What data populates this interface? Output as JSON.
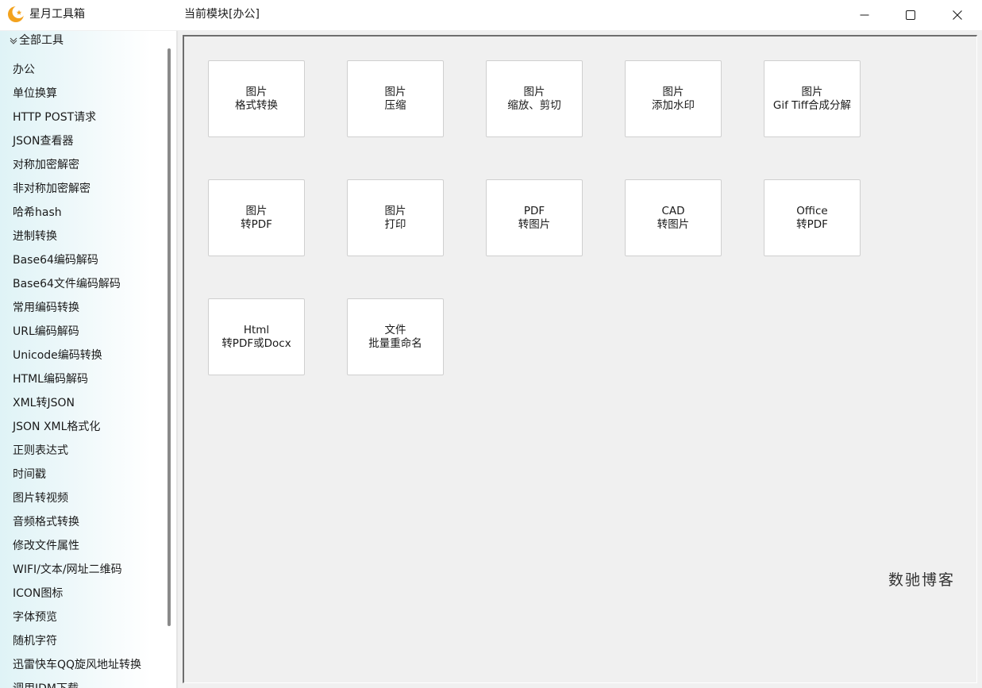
{
  "app": {
    "title": "星月工具箱",
    "module_title": "当前模块[办公]",
    "logo_icon": "crescent-moon-star-icon",
    "accent": "#f0a020"
  },
  "window_controls": {
    "minimize_icon": "minimize-icon",
    "maximize_icon": "maximize-icon",
    "close_icon": "close-icon"
  },
  "sidebar": {
    "root_label": "全部工具",
    "root_icon": "chevron-down-icon",
    "items": [
      "办公",
      "单位换算",
      "HTTP POST请求",
      "JSON查看器",
      "对称加密解密",
      "非对称加密解密",
      "哈希hash",
      "进制转换",
      "Base64编码解码",
      "Base64文件编码解码",
      "常用编码转换",
      "URL编码解码",
      "Unicode编码转换",
      "HTML编码解码",
      "XML转JSON",
      "JSON XML格式化",
      "正则表达式",
      "时间戳",
      "图片转视频",
      "音频格式转换",
      "修改文件属性",
      "WIFI/文本/网址二维码",
      "ICON图标",
      "字体预览",
      "随机字符",
      "迅雷快车QQ旋风地址转换",
      "调用IDM下载"
    ]
  },
  "tools": [
    {
      "line1": "图片",
      "line2": "格式转换"
    },
    {
      "line1": "图片",
      "line2": "压缩"
    },
    {
      "line1": "图片",
      "line2": "缩放、剪切"
    },
    {
      "line1": "图片",
      "line2": "添加水印"
    },
    {
      "line1": "图片",
      "line2": "Gif Tiff合成分解"
    },
    {
      "line1": "图片",
      "line2": "转PDF"
    },
    {
      "line1": "图片",
      "line2": "打印"
    },
    {
      "line1": "PDF",
      "line2": "转图片"
    },
    {
      "line1": "CAD",
      "line2": "转图片"
    },
    {
      "line1": "Office",
      "line2": "转PDF"
    },
    {
      "line1": "Html",
      "line2": "转PDF或Docx"
    },
    {
      "line1": "文件",
      "line2": "批量重命名"
    }
  ],
  "watermark": "数驰博客"
}
